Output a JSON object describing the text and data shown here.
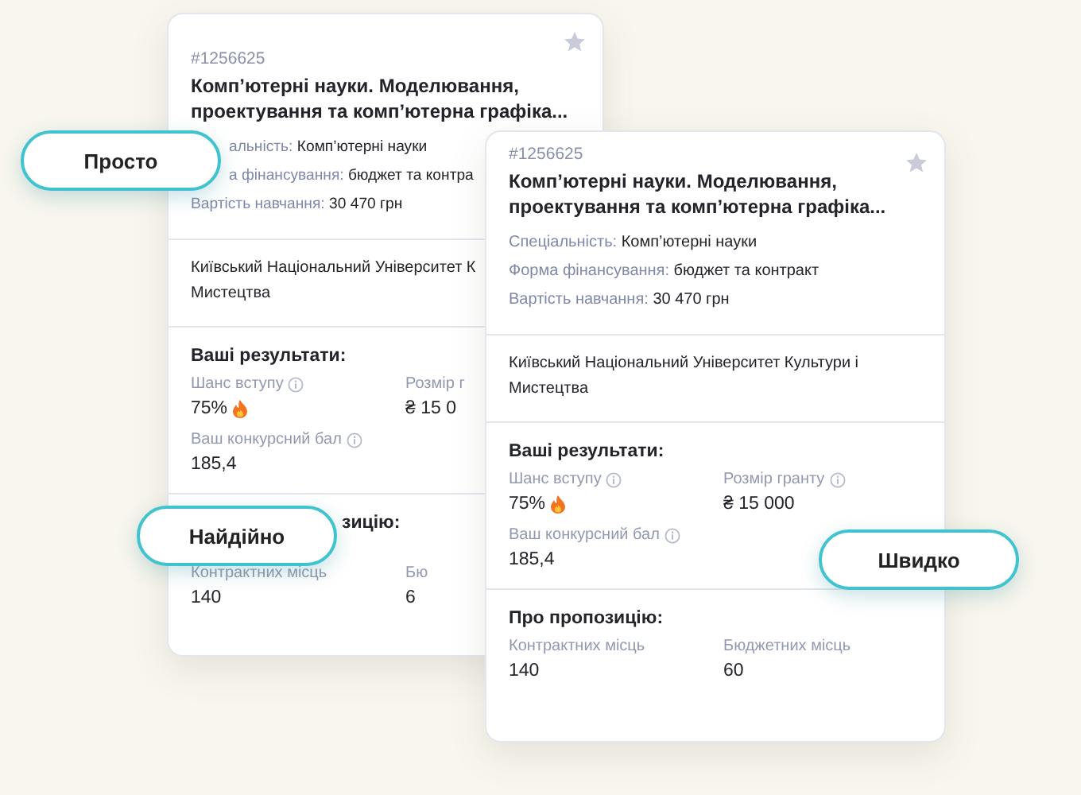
{
  "cards": [
    {
      "id": "#1256625",
      "title": "Комп’ютерні науки. Моделювання, проектування та комп’ютерна графіка...",
      "starred": false,
      "details": [
        {
          "label": "альність:",
          "value": "Комп’ютерні науки"
        },
        {
          "label": "а фінансування:",
          "value": "бюджет та контра"
        },
        {
          "label": "Вартість навчання:",
          "value": "30 470 грн"
        }
      ],
      "university": "Київський Національний Університет К\nМистецтва",
      "results_heading": "Ваші результати:",
      "results": [
        {
          "label": "Шанс вступу",
          "value": "75%",
          "info": true,
          "hot": true
        },
        {
          "label": "Розмір г",
          "value": "₴ 15 0",
          "info": false,
          "hot": false
        },
        {
          "label": "Ваш конкурсний бал",
          "value": "185,4",
          "info": true,
          "hot": false
        }
      ],
      "offer_heading": "зицію:",
      "offer": [
        {
          "label": "Контрактних місць",
          "value": "140"
        },
        {
          "label": "Бю",
          "value": "6"
        }
      ]
    },
    {
      "id": "#1256625",
      "title": "Комп’ютерні науки. Моделювання, проектування та комп’ютерна графіка...",
      "starred": false,
      "details": [
        {
          "label": "Спеціальність:",
          "value": "Комп’ютерні науки"
        },
        {
          "label": "Форма фінансування:",
          "value": "бюджет та контракт"
        },
        {
          "label": "Вартість навчання:",
          "value": "30 470 грн"
        }
      ],
      "university": "Київський Національний Університет Культури і\nМистецтва",
      "results_heading": "Ваші результати:",
      "results": [
        {
          "label": "Шанс вступу",
          "value": "75%",
          "info": true,
          "hot": true
        },
        {
          "label": "Розмір гранту",
          "value": "₴ 15 000",
          "info": true,
          "hot": false
        },
        {
          "label": "Ваш конкурсний бал",
          "value": "185,4",
          "info": true,
          "hot": false
        }
      ],
      "offer_heading": "Про пропозицію:",
      "offer": [
        {
          "label": "Контрактних місць",
          "value": "140"
        },
        {
          "label": "Бюджетних місць",
          "value": "60"
        }
      ]
    }
  ],
  "badges": [
    {
      "label": "Просто"
    },
    {
      "label": "Найдійно"
    },
    {
      "label": "Швидко"
    }
  ]
}
